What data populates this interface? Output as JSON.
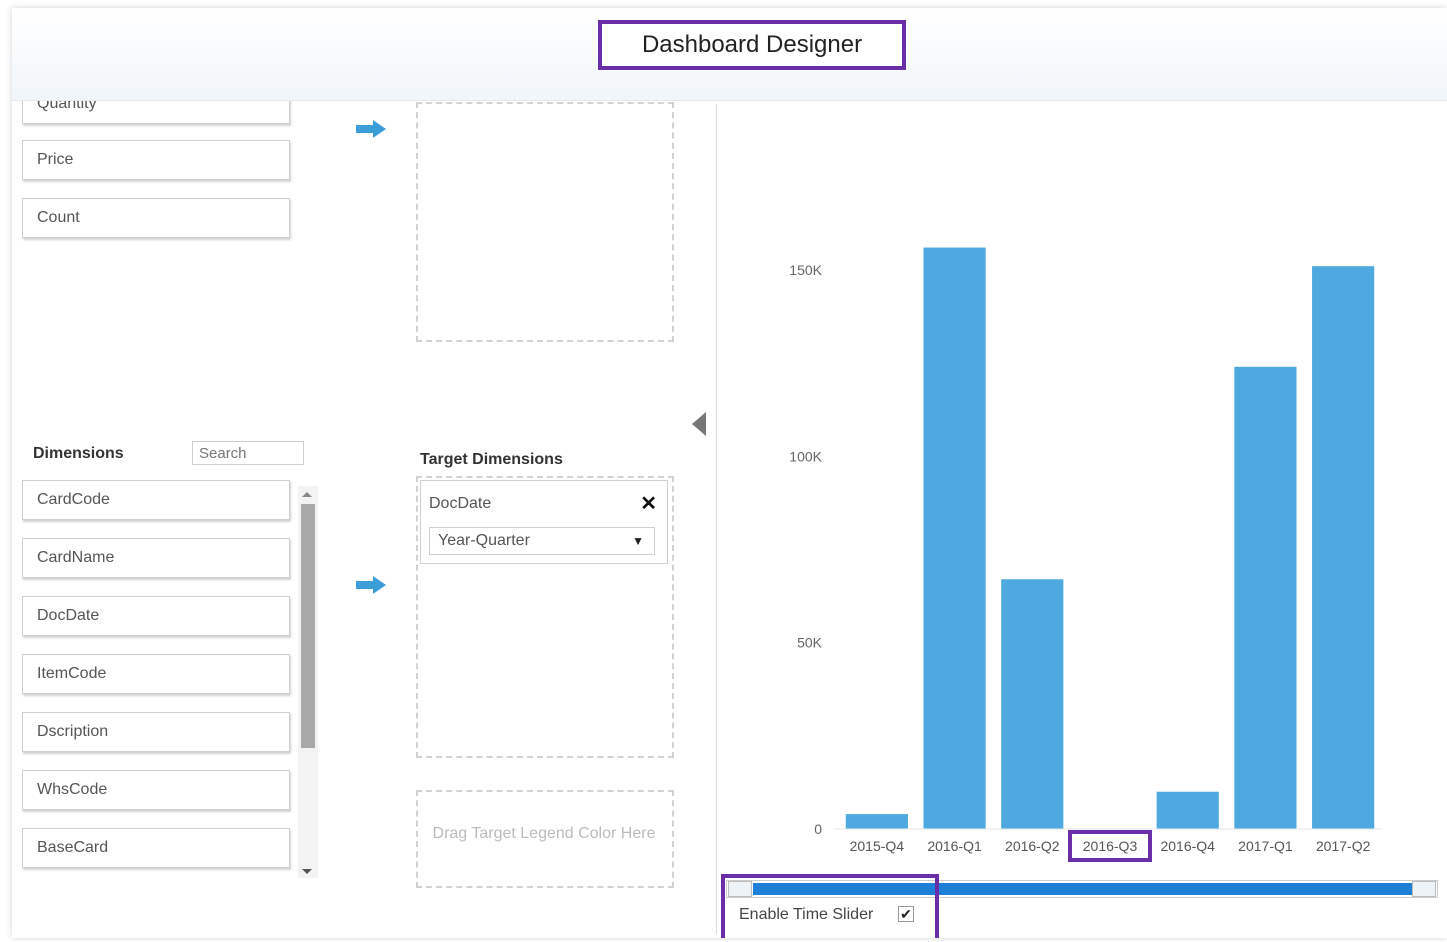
{
  "header": {
    "title": "Dashboard Designer"
  },
  "measures": {
    "items": [
      {
        "label": "Quantity"
      },
      {
        "label": "Price"
      },
      {
        "label": "Count"
      }
    ]
  },
  "dimensions": {
    "heading": "Dimensions",
    "search_placeholder": "Search",
    "items": [
      {
        "label": "CardCode"
      },
      {
        "label": "CardName"
      },
      {
        "label": "DocDate"
      },
      {
        "label": "ItemCode"
      },
      {
        "label": "Dscription"
      },
      {
        "label": "WhsCode"
      },
      {
        "label": "BaseCard"
      }
    ]
  },
  "target": {
    "heading": "Target Dimensions",
    "card_title": "DocDate",
    "close_glyph": "✕",
    "select_value": "Year-Quarter",
    "select_caret": "▼",
    "legend_drop_text": "Drag Target Legend Color Here"
  },
  "time_slider": {
    "label": "Enable Time Slider",
    "checked": true,
    "check_glyph": "✔"
  },
  "colors": {
    "bar": "#4da9e0",
    "highlight": "#6a2fa8",
    "arrow": "#3b9ed8",
    "slider": "#1e7fd6"
  },
  "chart_data": {
    "type": "bar",
    "categories": [
      "2015-Q4",
      "2016-Q1",
      "2016-Q2",
      "2016-Q3",
      "2016-Q4",
      "2017-Q1",
      "2017-Q2"
    ],
    "values": [
      4000,
      156000,
      67000,
      0,
      10000,
      124000,
      151000
    ],
    "yticks": [
      0,
      50000,
      100000,
      150000
    ],
    "ytick_labels": [
      "0",
      "50K",
      "100K",
      "150K"
    ],
    "ylim": [
      0,
      165000
    ],
    "highlighted_category": "2016-Q3",
    "title": "",
    "xlabel": "",
    "ylabel": "",
    "grid": false
  }
}
